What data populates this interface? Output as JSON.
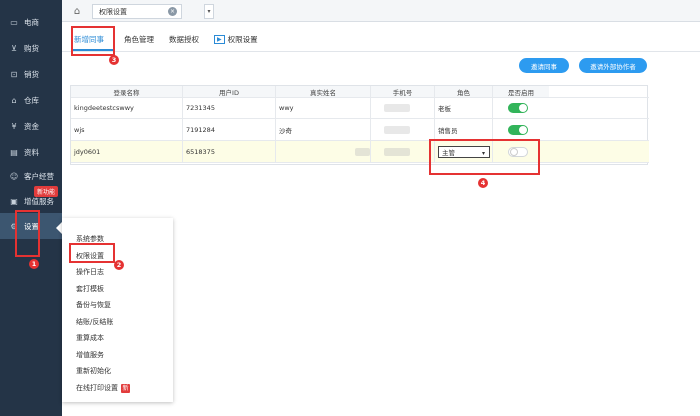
{
  "sidebar": {
    "items": [
      {
        "label": "电商",
        "icon": "monitor-icon",
        "glyph": "▭"
      },
      {
        "label": "购货",
        "icon": "cart-icon",
        "glyph": "⊻"
      },
      {
        "label": "销货",
        "icon": "sales-icon",
        "glyph": "⊡"
      },
      {
        "label": "仓库",
        "icon": "warehouse-icon",
        "glyph": "⌂"
      },
      {
        "label": "资金",
        "icon": "money-icon",
        "glyph": "¥"
      },
      {
        "label": "资料",
        "icon": "document-icon",
        "glyph": "▤"
      },
      {
        "label": "客户经营",
        "icon": "customer-icon",
        "glyph": "☺"
      },
      {
        "label": "增值服务",
        "icon": "service-icon",
        "glyph": "▣"
      },
      {
        "label": "设置",
        "icon": "gear-icon",
        "glyph": "⚙"
      }
    ],
    "new_badge": "新功能"
  },
  "topbar": {
    "tab_label": "权限设置",
    "home_glyph": "⌂",
    "close_glyph": "×",
    "dropdown_glyph": "▾"
  },
  "subtabs": {
    "add_colleague": "新增同事",
    "role_management": "角色管理",
    "data_authorization": "数据授权",
    "permission_settings": "权限设置",
    "video_glyph": "▶"
  },
  "buttons": {
    "invite_colleague": "邀请同事",
    "invite_external": "邀请外部协作者"
  },
  "table": {
    "headers": [
      "登录名称",
      "用户ID",
      "真实姓名",
      "手机号",
      "角色",
      "是否启用"
    ],
    "rows": [
      {
        "login": "kingdeetestcswwy",
        "user_id": "7231345",
        "real_name": "wwy",
        "role": "老板",
        "enabled": true
      },
      {
        "login": "wjs",
        "user_id": "7191284",
        "real_name": "沙奇",
        "role": "销售员",
        "enabled": true
      },
      {
        "login": "jdy0601",
        "user_id": "6518375",
        "real_name": "",
        "role": "主管",
        "enabled": false
      }
    ],
    "select_caret": "▾"
  },
  "menu": {
    "items": [
      "系统参数",
      "权限设置",
      "操作日志",
      "套打模板",
      "备份与恢复",
      "结账/反结账",
      "重算成本",
      "增值服务",
      "重新初始化",
      "在线打印设置"
    ],
    "new_tag": "新"
  },
  "markers": [
    "1",
    "2",
    "3",
    "4"
  ],
  "colors": {
    "sidebar_bg": "#243447",
    "accent_blue": "#2d9bf0",
    "toggle_on": "#32b45a",
    "annotation_red": "#e53232"
  }
}
